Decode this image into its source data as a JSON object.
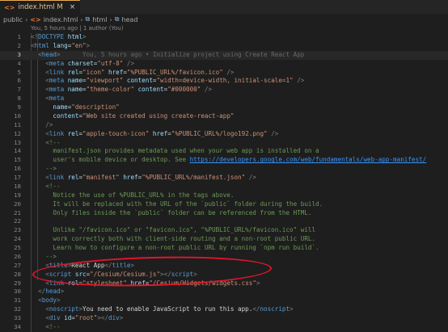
{
  "tab": {
    "icon": "<>",
    "title": "index.html M",
    "close": "×"
  },
  "breadcrumb": [
    {
      "text": "public",
      "type": "folder"
    },
    {
      "text": "index.html",
      "type": "file"
    },
    {
      "text": "html",
      "type": "tag"
    },
    {
      "text": "head",
      "type": "tag"
    }
  ],
  "blame_header": "You, 5 hours ago | 1 author (You)",
  "colors": {
    "tag": "#569cd6",
    "attr": "#9cdcfe",
    "string": "#ce9178",
    "comment": "#6a9955",
    "text": "#d4d4d4",
    "link": "#3794ff",
    "circle": "#e2162b"
  },
  "lines": [
    {
      "n": "1",
      "t": [
        [
          "<!",
          "p"
        ],
        [
          "DOCTYPE",
          "k"
        ],
        [
          " html",
          "a"
        ],
        [
          ">",
          "p"
        ]
      ]
    },
    {
      "n": "2",
      "t": [
        [
          "<",
          "p"
        ],
        [
          "html",
          "k"
        ],
        [
          " lang",
          "a"
        ],
        [
          "=",
          "t"
        ],
        [
          "\"en\"",
          "s"
        ],
        [
          ">",
          "p"
        ]
      ]
    },
    {
      "n": "3",
      "cur": true,
      "t": [
        [
          "  <",
          "p"
        ],
        [
          "head",
          "k"
        ],
        [
          ">",
          "p"
        ]
      ],
      "inlay": "      You, 5 hours ago • Initialize project using Create React App"
    },
    {
      "n": "4",
      "t": [
        [
          "    <",
          "p"
        ],
        [
          "meta",
          "k"
        ],
        [
          " charset",
          "a"
        ],
        [
          "=",
          "t"
        ],
        [
          "\"utf-8\"",
          "s"
        ],
        [
          " />",
          "p"
        ]
      ]
    },
    {
      "n": "5",
      "t": [
        [
          "    <",
          "p"
        ],
        [
          "link",
          "k"
        ],
        [
          " rel",
          "a"
        ],
        [
          "=",
          "t"
        ],
        [
          "\"icon\"",
          "s"
        ],
        [
          " href",
          "a"
        ],
        [
          "=",
          "t"
        ],
        [
          "\"%PUBLIC_URL%/favicon.ico\"",
          "s"
        ],
        [
          " />",
          "p"
        ]
      ]
    },
    {
      "n": "6",
      "t": [
        [
          "    <",
          "p"
        ],
        [
          "meta",
          "k"
        ],
        [
          " name",
          "a"
        ],
        [
          "=",
          "t"
        ],
        [
          "\"viewport\"",
          "s"
        ],
        [
          " content",
          "a"
        ],
        [
          "=",
          "t"
        ],
        [
          "\"width=device-width, initial-scale=1\"",
          "s"
        ],
        [
          " />",
          "p"
        ]
      ]
    },
    {
      "n": "7",
      "t": [
        [
          "    <",
          "p"
        ],
        [
          "meta",
          "k"
        ],
        [
          " name",
          "a"
        ],
        [
          "=",
          "t"
        ],
        [
          "\"theme-color\"",
          "s"
        ],
        [
          " content",
          "a"
        ],
        [
          "=",
          "t"
        ],
        [
          "\"#000000\"",
          "s"
        ],
        [
          " />",
          "p"
        ]
      ]
    },
    {
      "n": "8",
      "t": [
        [
          "    <",
          "p"
        ],
        [
          "meta",
          "k"
        ]
      ]
    },
    {
      "n": "9",
      "t": [
        [
          "      name",
          "a"
        ],
        [
          "=",
          "t"
        ],
        [
          "\"description\"",
          "s"
        ]
      ]
    },
    {
      "n": "10",
      "t": [
        [
          "      content",
          "a"
        ],
        [
          "=",
          "t"
        ],
        [
          "\"Web site created using create-react-app\"",
          "s"
        ]
      ]
    },
    {
      "n": "11",
      "t": [
        [
          "    />",
          "p"
        ]
      ]
    },
    {
      "n": "12",
      "t": [
        [
          "    <",
          "p"
        ],
        [
          "link",
          "k"
        ],
        [
          " rel",
          "a"
        ],
        [
          "=",
          "t"
        ],
        [
          "\"apple-touch-icon\"",
          "s"
        ],
        [
          " href",
          "a"
        ],
        [
          "=",
          "t"
        ],
        [
          "\"%PUBLIC_URL%/logo192.png\"",
          "s"
        ],
        [
          " />",
          "p"
        ]
      ]
    },
    {
      "n": "13",
      "t": [
        [
          "    <!--",
          "c"
        ]
      ]
    },
    {
      "n": "14",
      "t": [
        [
          "      manifest.json provides metadata used when your web app is installed on a",
          "c"
        ]
      ]
    },
    {
      "n": "15",
      "t": [
        [
          "      user's mobile device or desktop. See ",
          "c"
        ],
        [
          "https://developers.google.com/web/fundamentals/web-app-manifest/",
          "u"
        ]
      ]
    },
    {
      "n": "16",
      "t": [
        [
          "    -->",
          "c"
        ]
      ]
    },
    {
      "n": "17",
      "t": [
        [
          "    <",
          "p"
        ],
        [
          "link",
          "k"
        ],
        [
          " rel",
          "a"
        ],
        [
          "=",
          "t"
        ],
        [
          "\"manifest\"",
          "s"
        ],
        [
          " href",
          "a"
        ],
        [
          "=",
          "t"
        ],
        [
          "\"%PUBLIC_URL%/manifest.json\"",
          "s"
        ],
        [
          " />",
          "p"
        ]
      ]
    },
    {
      "n": "18",
      "t": [
        [
          "    <!--",
          "c"
        ]
      ]
    },
    {
      "n": "19",
      "t": [
        [
          "      Notice the use of %PUBLIC_URL% in the tags above.",
          "c"
        ]
      ]
    },
    {
      "n": "20",
      "t": [
        [
          "      It will be replaced with the URL of the `public` folder during the build.",
          "c"
        ]
      ]
    },
    {
      "n": "21",
      "t": [
        [
          "      Only files inside the `public` folder can be referenced from the HTML.",
          "c"
        ]
      ]
    },
    {
      "n": "22",
      "t": [
        [
          "",
          "c"
        ]
      ]
    },
    {
      "n": "23",
      "t": [
        [
          "      Unlike \"/favicon.ico\" or \"favicon.ico\", \"%PUBLIC_URL%/favicon.ico\" will",
          "c"
        ]
      ]
    },
    {
      "n": "24",
      "t": [
        [
          "      work correctly both with client-side routing and a non-root public URL.",
          "c"
        ]
      ]
    },
    {
      "n": "25",
      "t": [
        [
          "      Learn how to configure a non-root public URL by running `npm run build`.",
          "c"
        ]
      ]
    },
    {
      "n": "26",
      "t": [
        [
          "    -->",
          "c"
        ]
      ]
    },
    {
      "n": "27",
      "t": [
        [
          "    <",
          "p"
        ],
        [
          "title",
          "k"
        ],
        [
          ">",
          "p"
        ],
        [
          "React App",
          "t"
        ],
        [
          "</",
          "p"
        ],
        [
          "title",
          "k"
        ],
        [
          ">",
          "p"
        ]
      ]
    },
    {
      "n": "28",
      "t": [
        [
          "    <",
          "p"
        ],
        [
          "script",
          "k"
        ],
        [
          " src",
          "a"
        ],
        [
          "=",
          "t"
        ],
        [
          "\"/Cesium/Cesium.js\"",
          "s"
        ],
        [
          "></",
          "p"
        ],
        [
          "script",
          "k"
        ],
        [
          ">",
          "p"
        ]
      ]
    },
    {
      "n": "29",
      "t": [
        [
          "    <",
          "p"
        ],
        [
          "link",
          "k"
        ],
        [
          " rel",
          "a"
        ],
        [
          "=",
          "t"
        ],
        [
          "\"stylesheet\"",
          "s"
        ],
        [
          " href",
          "a"
        ],
        [
          "=",
          "t"
        ],
        [
          "\"/Cesium/Widgets/widgets.css\"",
          "s"
        ],
        [
          ">",
          "p"
        ]
      ]
    },
    {
      "n": "30",
      "t": [
        [
          "  </",
          "p"
        ],
        [
          "head",
          "k"
        ],
        [
          ">",
          "p"
        ]
      ]
    },
    {
      "n": "31",
      "t": [
        [
          "  <",
          "p"
        ],
        [
          "body",
          "k"
        ],
        [
          ">",
          "p"
        ]
      ]
    },
    {
      "n": "32",
      "t": [
        [
          "    <",
          "p"
        ],
        [
          "noscript",
          "k"
        ],
        [
          ">",
          "p"
        ],
        [
          "You need to enable JavaScript to run this app.",
          "t"
        ],
        [
          "</",
          "p"
        ],
        [
          "noscript",
          "k"
        ],
        [
          ">",
          "p"
        ]
      ]
    },
    {
      "n": "33",
      "t": [
        [
          "    <",
          "p"
        ],
        [
          "div",
          "k"
        ],
        [
          " id",
          "a"
        ],
        [
          "=",
          "t"
        ],
        [
          "\"root\"",
          "s"
        ],
        [
          "></",
          "p"
        ],
        [
          "div",
          "k"
        ],
        [
          ">",
          "p"
        ]
      ]
    },
    {
      "n": "34",
      "t": [
        [
          "    <!--",
          "c"
        ]
      ]
    }
  ]
}
